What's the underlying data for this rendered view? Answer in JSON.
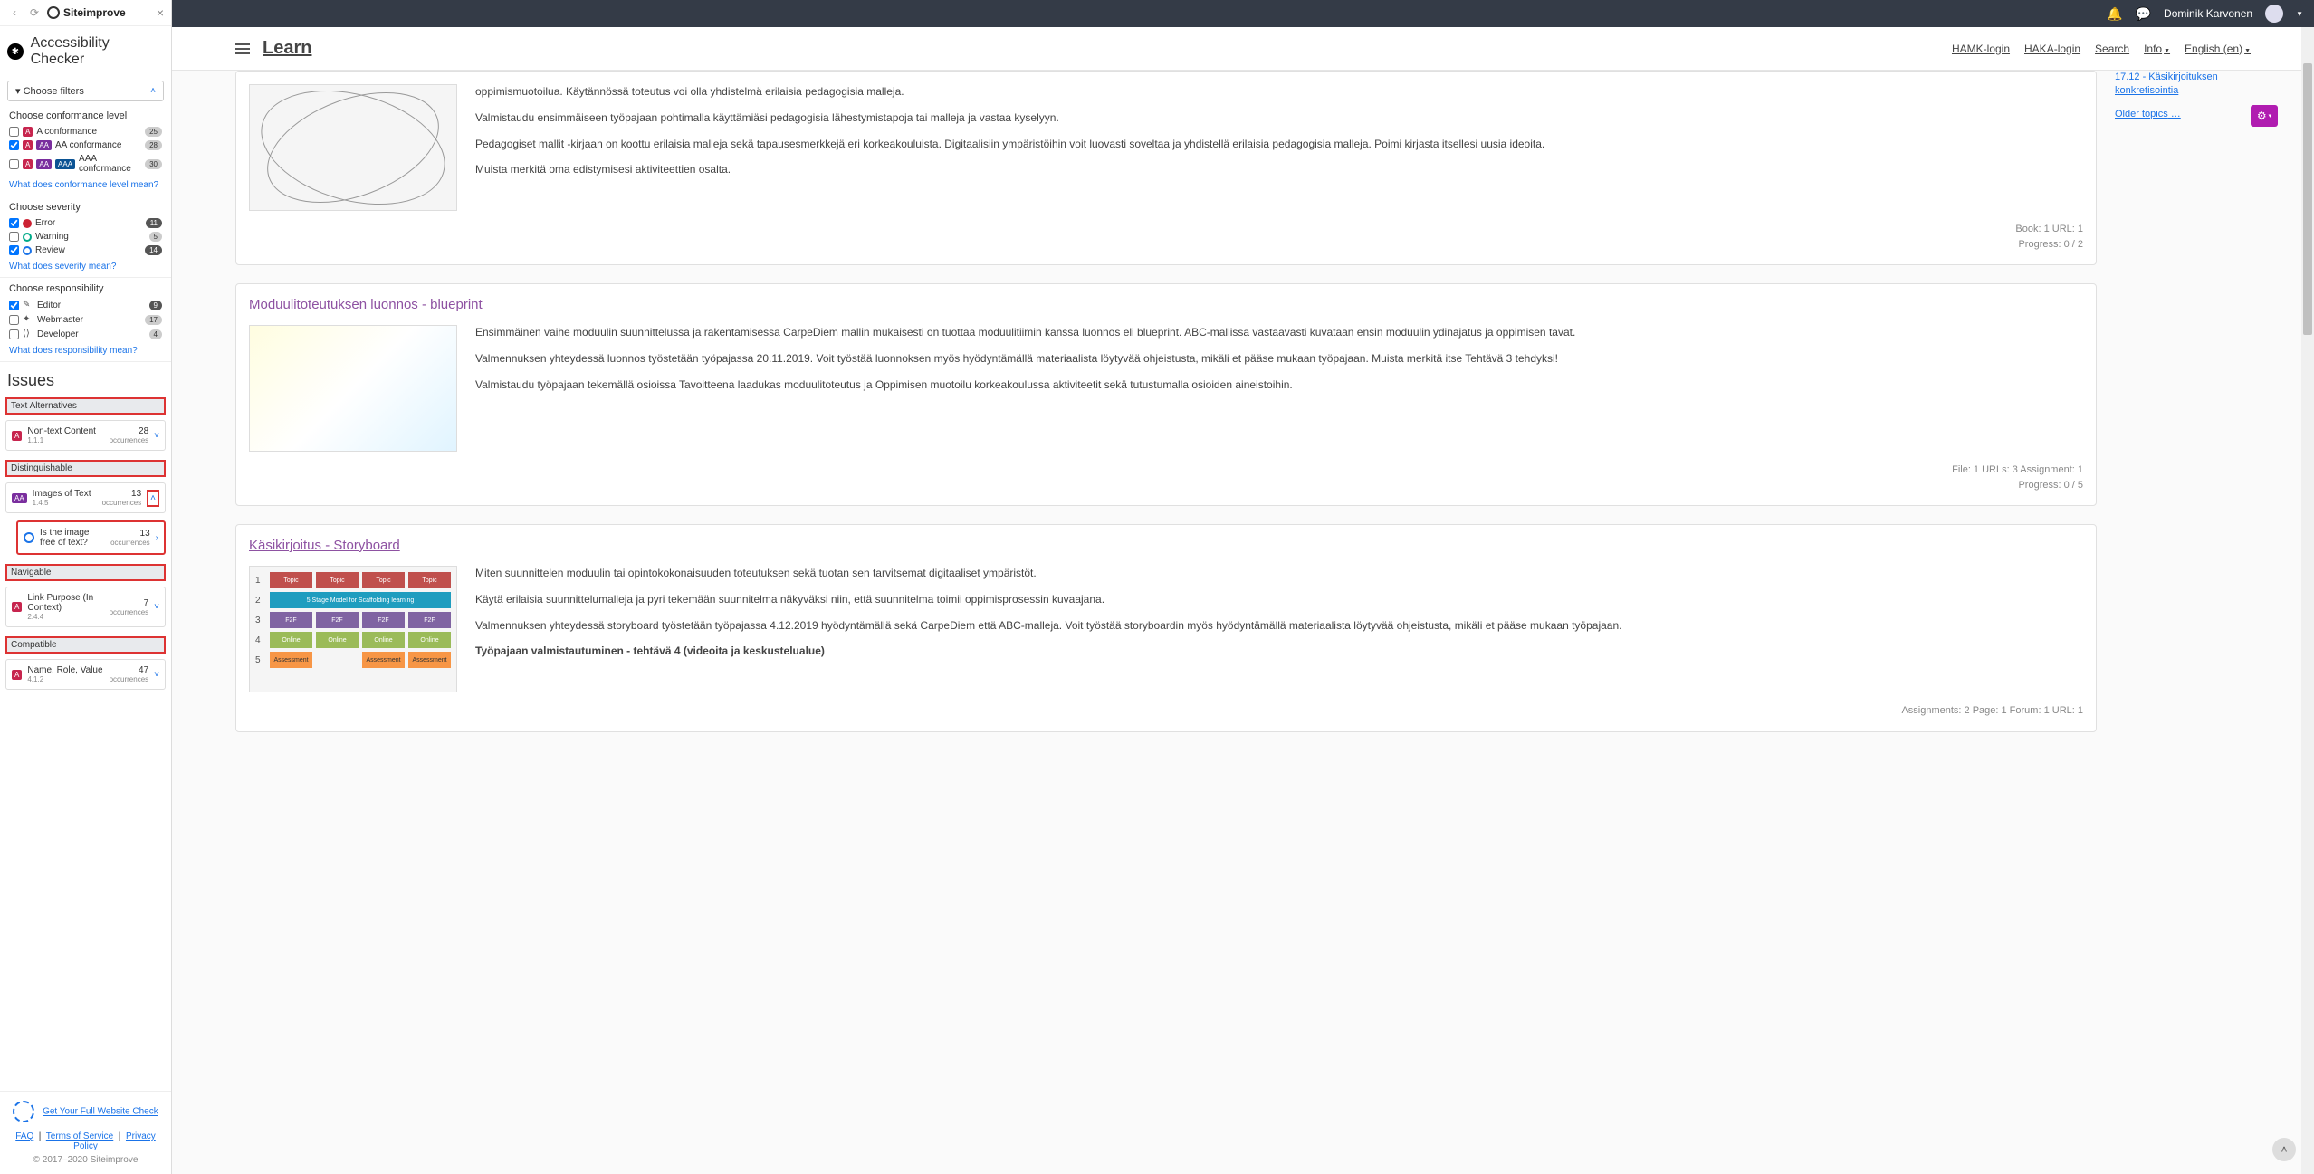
{
  "siteimprove": {
    "brand": "Siteimprove",
    "checker_title": "Accessibility Checker",
    "choose_filters": "Choose filters",
    "conformance": {
      "title": "Choose conformance level",
      "a_label": "A conformance",
      "a_count": "25",
      "aa_label": "AA conformance",
      "aa_count": "28",
      "aaa_label": "AAA conformance",
      "aaa_count": "30",
      "help": "What does conformance level mean?"
    },
    "severity": {
      "title": "Choose severity",
      "error": "Error",
      "error_count": "11",
      "warning": "Warning",
      "warning_count": "5",
      "review": "Review",
      "review_count": "14",
      "help": "What does severity mean?"
    },
    "responsibility": {
      "title": "Choose responsibility",
      "editor": "Editor",
      "editor_count": "9",
      "webmaster": "Webmaster",
      "webmaster_count": "17",
      "developer": "Developer",
      "developer_count": "4",
      "help": "What does responsibility mean?"
    },
    "issues_title": "Issues",
    "categories": {
      "text_alt": {
        "label": "Text Alternatives",
        "issue_name": "Non-text Content",
        "issue_ref": "1.1.1",
        "count": "28",
        "occ": "occurrences"
      },
      "dist": {
        "label": "Distinguishable",
        "issue_name": "Images of Text",
        "issue_ref": "1.4.5",
        "count": "13",
        "occ": "occurrences",
        "sub_q": "Is the image free of text?",
        "sub_count": "13",
        "sub_occ": "occurrences"
      },
      "nav": {
        "label": "Navigable",
        "issue_name": "Link Purpose (In Context)",
        "issue_ref": "2.4.4",
        "count": "7",
        "occ": "occurrences"
      },
      "compat": {
        "label": "Compatible",
        "issue_name": "Name, Role, Value",
        "issue_ref": "4.1.2",
        "count": "47",
        "occ": "occurrences"
      }
    },
    "footer": {
      "full_check": "Get Your Full Website Check",
      "faq": "FAQ",
      "tos": "Terms of Service",
      "privacy": "Privacy Policy",
      "copyright": "© 2017–2020 Siteimprove"
    }
  },
  "topbar": {
    "user": "Dominik Karvonen"
  },
  "navbar": {
    "learn": "Learn",
    "hamk": "HAMK-login",
    "haka": "HAKA-login",
    "search": "Search",
    "info": "Info",
    "lang": "English (en)"
  },
  "sidewidget": {
    "line1": "17.12 - Käsikirjoituksen",
    "line2": "konkretisointia",
    "older": "Older topics"
  },
  "card1": {
    "p1": "oppimismuotoilua. Käytännössä toteutus voi olla yhdistelmä erilaisia pedagogisia malleja.",
    "p2": "Valmistaudu ensimmäiseen työpajaan pohtimalla käyttämiäsi pedagogisia lähestymistapoja tai malleja ja vastaa kyselyyn.",
    "p3": "Pedagogiset mallit -kirjaan on koottu erilaisia malleja sekä tapausesmerkkejä eri korkeakouluista. Digitaalisiin ympäristöihin voit luovasti soveltaa ja yhdistellä erilaisia pedagogisia malleja. Poimi kirjasta itsellesi uusia ideoita.",
    "p4": "Muista merkitä oma edistymisesi aktiviteettien osalta.",
    "meta1": "Book: 1   URL: 1",
    "meta2": "Progress: 0 / 2"
  },
  "card2": {
    "title": "Moduulitoteutuksen luonnos - blueprint",
    "p1": "Ensimmäinen vaihe moduulin suunnittelussa ja rakentamisessa CarpeDiem mallin mukaisesti on tuottaa moduulitiimin kanssa luonnos eli blueprint. ABC-mallissa vastaavasti kuvataan ensin moduulin ydinajatus ja oppimisen tavat.",
    "p2": "Valmennuksen yhteydessä luonnos työstetään työpajassa 20.11.2019. Voit työstää luonnoksen myös hyödyntämällä materiaalista löytyvää ohjeistusta, mikäli et pääse mukaan työpajaan. Muista merkitä itse Tehtävä 3 tehdyksi!",
    "p3": "Valmistaudu työpajaan tekemällä osioissa Tavoitteena laadukas moduulitoteutus ja Oppimisen muotoilu korkeakoulussa aktiviteetit sekä tutustumalla osioiden aineistoihin.",
    "meta1": "File: 1   URLs: 3   Assignment: 1",
    "meta2": "Progress: 0 / 5"
  },
  "card3": {
    "title": "Käsikirjoitus - Storyboard",
    "p1": "Miten suunnittelen moduulin tai opintokokonaisuuden toteutuksen sekä tuotan sen tarvitsemat digitaaliset ympäristöt.",
    "p2": "Käytä erilaisia suunnittelumalleja ja pyri tekemään suunnitelma näkyväksi niin, että suunnitelma toimii oppimisprosessin kuvaajana.",
    "p3": "Valmennuksen yhteydessä storyboard työstetään työpajassa 4.12.2019 hyödyntämällä sekä CarpeDiem että ABC-malleja. Voit työstää storyboardin myös hyödyntämällä materiaalista löytyvää ohjeistusta, mikäli et pääse mukaan työpajaan.",
    "p4": "Työpajaan valmistautuminen - tehtävä 4 (videoita ja keskustelualue)",
    "meta1": "Assignments: 2   Page: 1   Forum: 1   URL: 1"
  }
}
